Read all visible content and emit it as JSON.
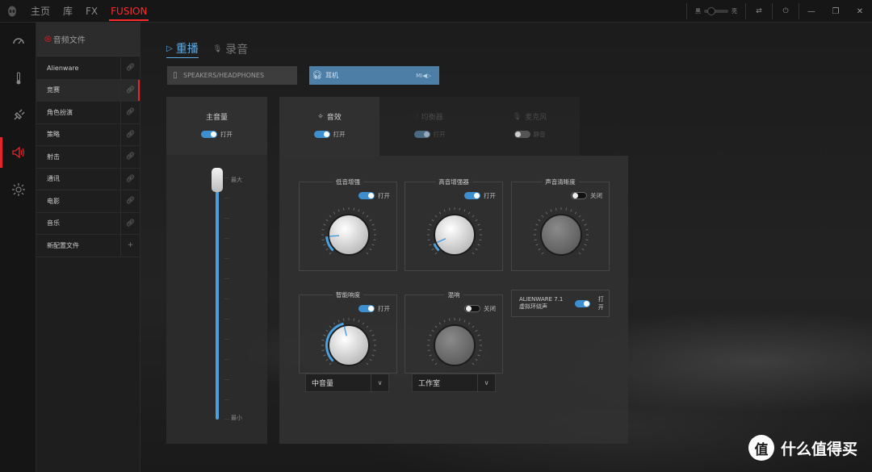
{
  "topbar": {
    "nav": [
      {
        "label": "主页"
      },
      {
        "label": "库"
      },
      {
        "label": "FX"
      },
      {
        "label": "FUSION",
        "active": true
      }
    ],
    "brightness_dark_label": "黑",
    "brightness_light_label": "亮",
    "accent_color": "#ff2b2b"
  },
  "rail": {
    "items": [
      {
        "icon": "gauge-icon"
      },
      {
        "icon": "thermometer-icon"
      },
      {
        "icon": "plug-icon"
      },
      {
        "icon": "speaker-icon",
        "active": true
      },
      {
        "icon": "sun-icon"
      }
    ]
  },
  "sidebar": {
    "header": "音频文件",
    "items": [
      {
        "label": "Alienware"
      },
      {
        "label": "竞赛",
        "active": true
      },
      {
        "label": "角色扮演"
      },
      {
        "label": "策略"
      },
      {
        "label": "射击"
      },
      {
        "label": "通讯"
      },
      {
        "label": "电影"
      },
      {
        "label": "音乐"
      },
      {
        "label": "新配置文件",
        "action": "+"
      }
    ]
  },
  "mode_tabs": {
    "playback": "重播",
    "record": "录音"
  },
  "devices": {
    "speakers": "SPEAKERS/HEADPHONES",
    "headphones": "耳机",
    "headphones_status": "MI◀▷"
  },
  "master": {
    "title": "主音量",
    "toggle_label": "打开",
    "max_label": "最大",
    "min_label": "最小",
    "volume_level": 1.0
  },
  "fx_tabs": {
    "effects": {
      "title": "音效",
      "toggle": "打开"
    },
    "equalizer": {
      "title": "均衡器",
      "toggle": "打开"
    },
    "microphone": {
      "title": "麦克风",
      "toggle": "静音"
    }
  },
  "effects": {
    "bass_boost": {
      "title": "低音增强",
      "toggle": "打开",
      "level": 0.15
    },
    "treble_boost": {
      "title": "高音增强器",
      "toggle": "打开",
      "level": 0.08
    },
    "voice_clarity": {
      "title": "声音清晰度",
      "toggle": "关闭"
    },
    "smart_volume": {
      "title": "智能响度",
      "toggle": "打开",
      "level": 0.45,
      "preset": "中音量"
    },
    "reverb": {
      "title": "混响",
      "toggle": "关闭",
      "preset": "工作室"
    },
    "surround": {
      "title": "ALIENWARE 7.1 虚拟环绕声",
      "toggle": "打开"
    }
  },
  "brand": {
    "mark": "值",
    "name": "什么值得买"
  },
  "colors": {
    "blue": "#4ba0dd",
    "red": "#e3262b"
  }
}
